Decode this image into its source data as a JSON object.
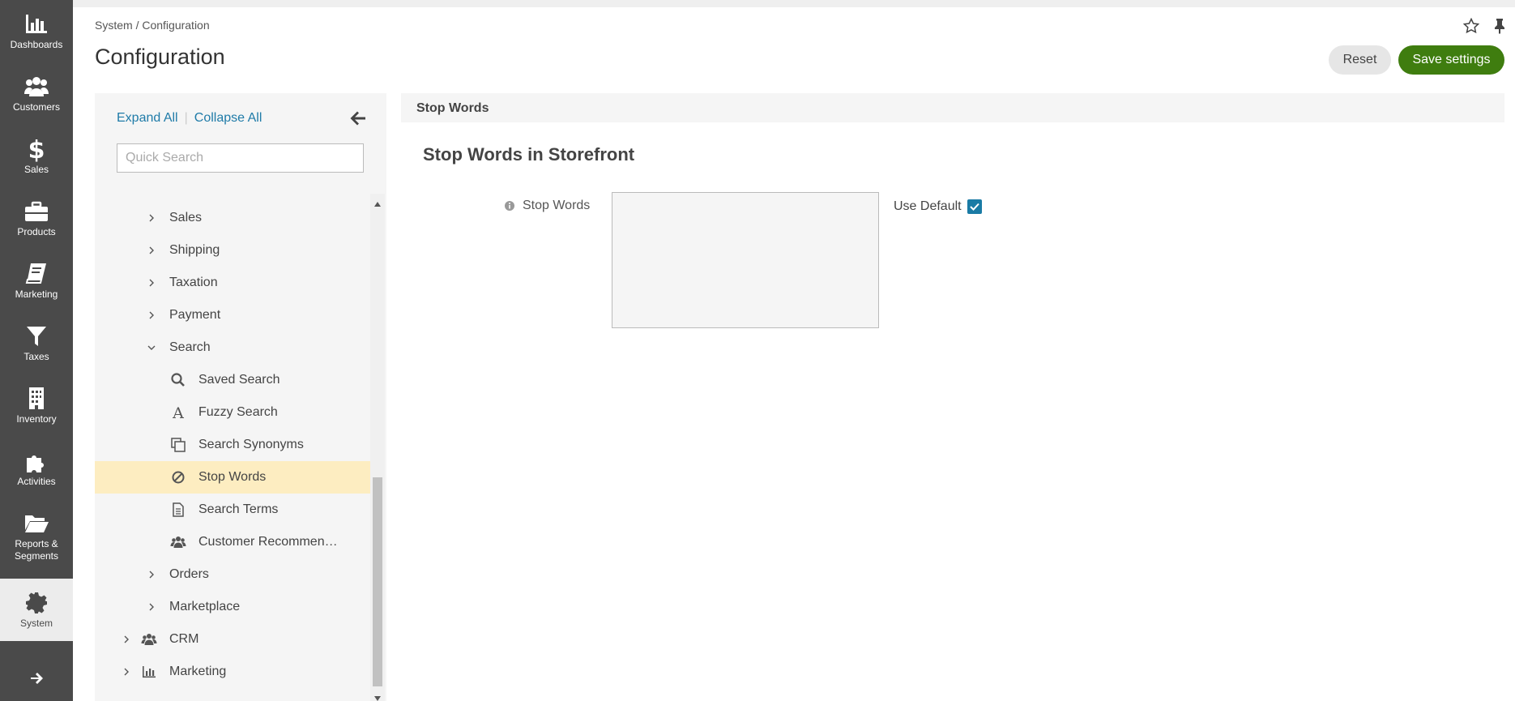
{
  "nav": {
    "items": [
      {
        "label": "Dashboards",
        "icon": "bar-chart-icon"
      },
      {
        "label": "Customers",
        "icon": "users-icon"
      },
      {
        "label": "Sales",
        "icon": "dollar-icon"
      },
      {
        "label": "Products",
        "icon": "briefcase-icon"
      },
      {
        "label": "Marketing",
        "icon": "book-icon"
      },
      {
        "label": "Taxes",
        "icon": "filter-icon"
      },
      {
        "label": "Inventory",
        "icon": "building-icon"
      },
      {
        "label": "Activities",
        "icon": "puzzle-icon"
      },
      {
        "label": "Reports & Segments",
        "icon": "folder-open-icon"
      },
      {
        "label": "System",
        "icon": "gear-icon"
      }
    ],
    "active": "System"
  },
  "header": {
    "breadcrumb": "System / Configuration",
    "title": "Configuration",
    "reset_label": "Reset",
    "save_label": "Save settings"
  },
  "tree": {
    "expand_all": "Expand All",
    "collapse_all": "Collapse All",
    "search_placeholder": "Quick Search",
    "items": [
      {
        "label": "Sales",
        "level": 1,
        "chevron": "right"
      },
      {
        "label": "Shipping",
        "level": 1,
        "chevron": "right"
      },
      {
        "label": "Taxation",
        "level": 1,
        "chevron": "right"
      },
      {
        "label": "Payment",
        "level": 1,
        "chevron": "right"
      },
      {
        "label": "Search",
        "level": 1,
        "chevron": "down"
      },
      {
        "label": "Saved Search",
        "level": 2,
        "icon": "search-icon"
      },
      {
        "label": "Fuzzy Search",
        "level": 2,
        "icon": "font-icon"
      },
      {
        "label": "Search Synonyms",
        "level": 2,
        "icon": "copy-icon"
      },
      {
        "label": "Stop Words",
        "level": 2,
        "icon": "ban-icon",
        "active": true
      },
      {
        "label": "Search Terms",
        "level": 2,
        "icon": "file-text-icon"
      },
      {
        "label": "Customer Recommen…",
        "level": 2,
        "icon": "users-icon"
      },
      {
        "label": "Orders",
        "level": 1,
        "chevron": "right"
      },
      {
        "label": "Marketplace",
        "level": 1,
        "chevron": "right"
      },
      {
        "label": "CRM",
        "level": 0,
        "chevron": "right",
        "icon": "users-icon"
      },
      {
        "label": "Marketing",
        "level": 0,
        "chevron": "right",
        "icon": "bar-chart-icon"
      }
    ]
  },
  "content": {
    "section_header": "Stop Words",
    "section_title": "Stop Words in Storefront",
    "field_label": "Stop Words",
    "field_value": "",
    "use_default_label": "Use Default",
    "use_default_checked": true
  },
  "colors": {
    "nav_bg": "#4a4a4a",
    "save_button": "#3f7d0f",
    "link": "#1f7ba8",
    "active_row": "#fdedc1",
    "checkbox": "#1a7ba5"
  }
}
